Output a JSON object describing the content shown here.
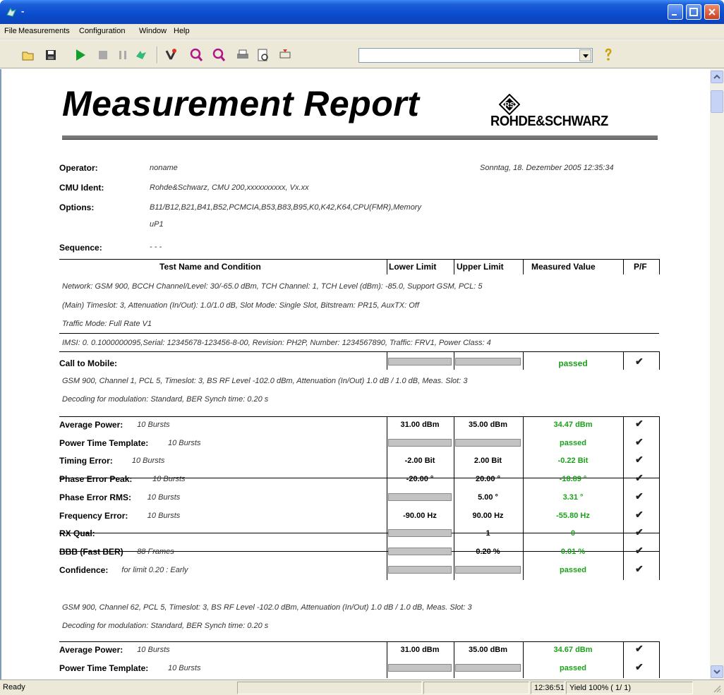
{
  "window": {
    "title": "-"
  },
  "menu": [
    {
      "label": "File"
    },
    {
      "label": "Measurements"
    },
    {
      "label": "Configuration"
    },
    {
      "label": "Window"
    },
    {
      "label": "Help"
    }
  ],
  "toolbar": {
    "icons": [
      "open-icon",
      "save-icon",
      "run-icon",
      "stop-icon",
      "pause-icon",
      "step-icon",
      "settings-icon",
      "zoom-in-icon",
      "zoom-out-icon",
      "print-icon",
      "preview-icon",
      "connect-icon",
      "help-icon"
    ],
    "combo_value": ""
  },
  "report": {
    "title": "Measurement Report",
    "logo_text": "ROHDE&SCHWARZ",
    "operator_label": "Operator:",
    "operator_value": "noname",
    "date": "Sonntag, 18. Dezember 2005  12:35:34",
    "cmu_label": "CMU Ident:",
    "cmu_value": "Rohde&Schwarz, CMU 200,xxxxxxxxxx, Vx.xx",
    "options_label": "Options:",
    "options_value": "B11/B12,B21,B41,B52,PCMCIA,B53,B83,B95,K0,K42,K64,CPU(FMR),Memory",
    "options_value2": "uP1",
    "sequence_label": "Sequence:",
    "sequence_value": "- - -",
    "headers": {
      "test": "Test Name and Condition",
      "lower": "Lower Limit",
      "upper": "Upper Limit",
      "measured": "Measured Value",
      "pf": "P/F"
    },
    "network1": "Network: GSM 900, BCCH Channel/Level: 30/-65.0 dBm, TCH Channel: 1, TCH Level (dBm): -85.0, Support GSM, PCL: 5",
    "network2": "(Main) Timeslot: 3, Attenuation (In/Out): 1.0/1.0 dB, Slot Mode: Single Slot, Bitstream: PR15, AuxTX: Off",
    "network3": "Traffic Mode: Full Rate V1",
    "imsi": "IMSI:   0. 0.1000000095,Serial: 12345678-123456-8-00, Revision: PH2P, Number: 1234567890, Traffic: FRV1, Power Class: 4",
    "call_label": "Call to Mobile:",
    "call_result": "passed",
    "cond1a": "GSM 900, Channel 1, PCL 5, Timeslot: 3, BS RF Level -102.0 dBm, Attenuation (In/Out) 1.0 dB / 1.0 dB, Meas. Slot: 3",
    "cond1b": "Decoding for modulation: Standard, BER Synch time: 0.20 s",
    "rows1": [
      {
        "name": "Average Power:",
        "cond": "10 Bursts",
        "lower": "31.00 dBm",
        "upper": "35.00 dBm",
        "measured": "34.47 dBm",
        "pf": "✔"
      },
      {
        "name": "Power Time Template:",
        "cond": "10 Bursts",
        "lower": "",
        "upper": "",
        "measured": "passed",
        "pf": "✔"
      },
      {
        "name": "Timing Error:",
        "cond": "10 Bursts",
        "lower": "-2.00 Bit",
        "upper": "2.00 Bit",
        "measured": "-0.22 Bit",
        "pf": "✔"
      },
      {
        "name": "Phase Error Peak:",
        "cond": "10 Bursts",
        "lower": "-20.00 °",
        "upper": "20.00 °",
        "measured": "-18.89 °",
        "pf": "✔"
      },
      {
        "name": "Phase Error RMS:",
        "cond": "10 Bursts",
        "lower": "",
        "upper": "5.00 °",
        "measured": "3.31 °",
        "pf": "✔"
      },
      {
        "name": "Frequency Error:",
        "cond": "10 Bursts",
        "lower": "-90.00 Hz",
        "upper": "90.00 Hz",
        "measured": "-55.80 Hz",
        "pf": "✔"
      },
      {
        "name": "RX Qual:",
        "cond": "",
        "lower": "",
        "upper": "1",
        "measured": "0",
        "pf": "✔"
      },
      {
        "name": "BBB (Fast BER)",
        "cond": "88 Frames",
        "lower": "",
        "upper": "0.20 %",
        "measured": "0.01 %",
        "pf": "✔"
      },
      {
        "name": "Confidence:",
        "cond": "for limit 0.20 : Early",
        "lower": "",
        "upper": "",
        "measured": "passed",
        "pf": "✔"
      }
    ],
    "cond2a": "GSM 900, Channel 62, PCL 5, Timeslot: 3, BS RF Level -102.0 dBm, Attenuation (In/Out) 1.0 dB / 1.0 dB, Meas. Slot: 3",
    "cond2b": "Decoding for modulation: Standard, BER Synch time: 0.20 s",
    "rows2": [
      {
        "name": "Average Power:",
        "cond": "10 Bursts",
        "lower": "31.00 dBm",
        "upper": "35.00 dBm",
        "measured": "34.67 dBm",
        "pf": "✔"
      },
      {
        "name": "Power Time Template:",
        "cond": "10 Bursts",
        "lower": "",
        "upper": "",
        "measured": "passed",
        "pf": "✔"
      }
    ]
  },
  "status": {
    "ready": "Ready",
    "time": "12:36:51",
    "yield": "Yield 100% (  1/  1)"
  },
  "colors": {
    "pass": "#1aa11a",
    "titlebar": "#0a4ccc"
  }
}
